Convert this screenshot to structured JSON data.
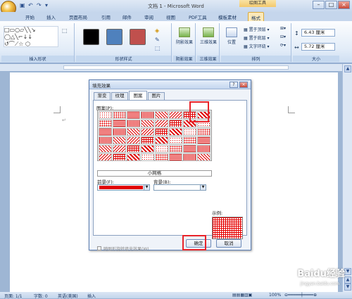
{
  "app": {
    "title": "文档 1 - Microsoft Word",
    "context_tab": "绘图工具"
  },
  "tabs": [
    "开始",
    "插入",
    "页面布局",
    "引用",
    "邮件",
    "审阅",
    "视图",
    "PDF工具",
    "模板素材",
    "格式"
  ],
  "ribbon": {
    "groups": {
      "insert_shapes": "插入形状",
      "shape_styles": "形状样式",
      "shadow_effects": "阴影效果",
      "three_d_effects": "三维效果",
      "arrange": "排列",
      "size": "大小"
    },
    "buttons": {
      "shadow": "阴影效果",
      "three_d": "三维效果",
      "position": "位置",
      "bring_front": "置于顶层",
      "send_back": "置于底层",
      "text_wrap": "文字环绕"
    },
    "style_colors": [
      "#000000",
      "#4f81bd",
      "#c0504d"
    ],
    "height_value": "6.43 厘米",
    "width_value": "5.72 厘米"
  },
  "dialog": {
    "title": "填充效果",
    "help": "?",
    "close": "×",
    "tabs": [
      "渐变",
      "纹理",
      "图案",
      "图片"
    ],
    "pattern_label": "图案(P):",
    "pattern_name": "小网格",
    "foreground_label": "前景(F):",
    "background_label": "背景(B):",
    "foreground_color": "#e00000",
    "sample_label": "示例:",
    "rotate_label": "随图形旋转填充效果(W)",
    "ok": "确定",
    "cancel": "取消"
  },
  "status": {
    "page": "页面: 1/1",
    "words": "字数: 0",
    "language": "英语(美国)",
    "mode": "插入",
    "zoom": "100%"
  },
  "watermark": {
    "brand": "Baidu经验",
    "url": "jingyan.baidu.com"
  }
}
